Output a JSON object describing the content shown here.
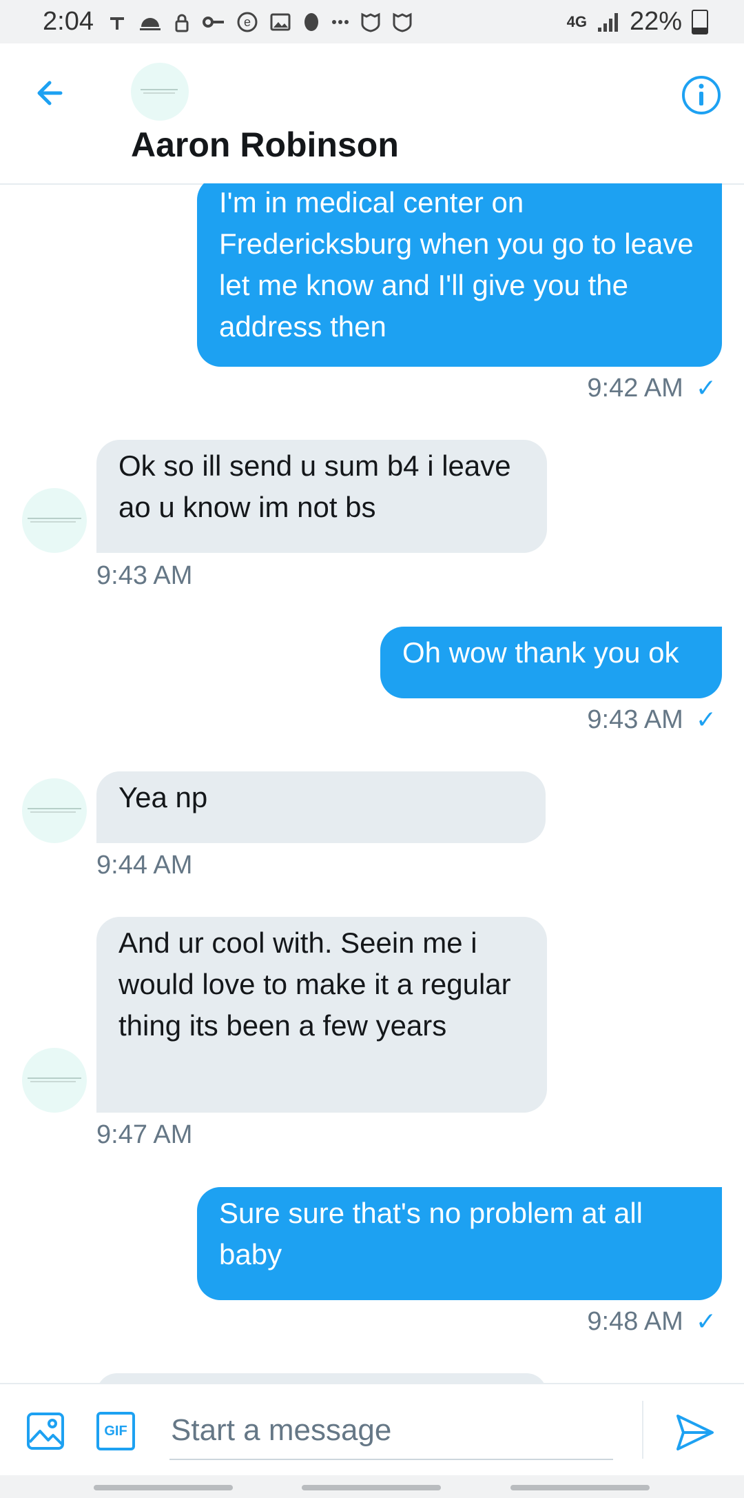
{
  "status_bar": {
    "time": "2:04",
    "network": "4G",
    "battery": "22%"
  },
  "header": {
    "name": "Aaron Robinson"
  },
  "messages": [
    {
      "direction": "out",
      "text": "I'm in medical center on Fredericksburg when you go to leave let me know and I'll give you the address then",
      "time": "9:42 AM"
    },
    {
      "direction": "in",
      "text": "Ok so ill send u sum b4 i leave ao u know im not bs",
      "time": "9:43 AM"
    },
    {
      "direction": "out",
      "text": "Oh wow thank you ok",
      "time": "9:43 AM"
    },
    {
      "direction": "in",
      "text": "Yea np",
      "time": "9:44 AM"
    },
    {
      "direction": "in",
      "text": "And ur cool with. Seein me i would love to make it a regular thing its been a few years",
      "time": "9:47 AM"
    },
    {
      "direction": "out",
      "text": "Sure sure that's no problem at all baby",
      "time": "9:48 AM"
    }
  ],
  "composer": {
    "placeholder": "Start a message",
    "gif_label": "GIF"
  },
  "colors": {
    "accent": "#1da1f2",
    "incoming_bubble": "#e6ecf0"
  }
}
